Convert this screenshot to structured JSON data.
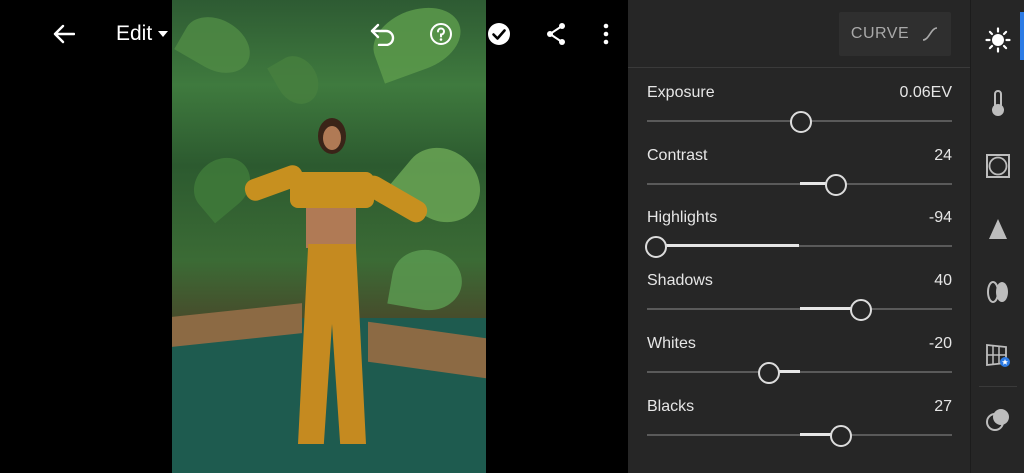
{
  "topbar": {
    "edit_label": "Edit",
    "icons": [
      "back-arrow-icon",
      "undo-icon",
      "help-icon",
      "done-check-icon",
      "share-icon",
      "more-options-icon"
    ]
  },
  "curve_button": {
    "label": "CURVE",
    "icon": "curve-icon"
  },
  "light_panel": {
    "sliders": [
      {
        "name": "exposure",
        "label": "Exposure",
        "value": "0.06EV",
        "min": -5,
        "max": 5,
        "numeric": 0.06
      },
      {
        "name": "contrast",
        "label": "Contrast",
        "value": "24",
        "min": -100,
        "max": 100,
        "numeric": 24
      },
      {
        "name": "highlights",
        "label": "Highlights",
        "value": "-94",
        "min": -100,
        "max": 100,
        "numeric": -94
      },
      {
        "name": "shadows",
        "label": "Shadows",
        "value": "40",
        "min": -100,
        "max": 100,
        "numeric": 40
      },
      {
        "name": "whites",
        "label": "Whites",
        "value": "-20",
        "min": -100,
        "max": 100,
        "numeric": -20
      },
      {
        "name": "blacks",
        "label": "Blacks",
        "value": "27",
        "min": -100,
        "max": 100,
        "numeric": 27
      }
    ]
  },
  "tool_rail": {
    "items": [
      "light-icon",
      "color-icon",
      "effects-icon",
      "detail-icon",
      "optics-icon",
      "geometry-icon",
      "masking-icon"
    ],
    "active": "light-icon",
    "accent_color": "#2c7be5"
  }
}
